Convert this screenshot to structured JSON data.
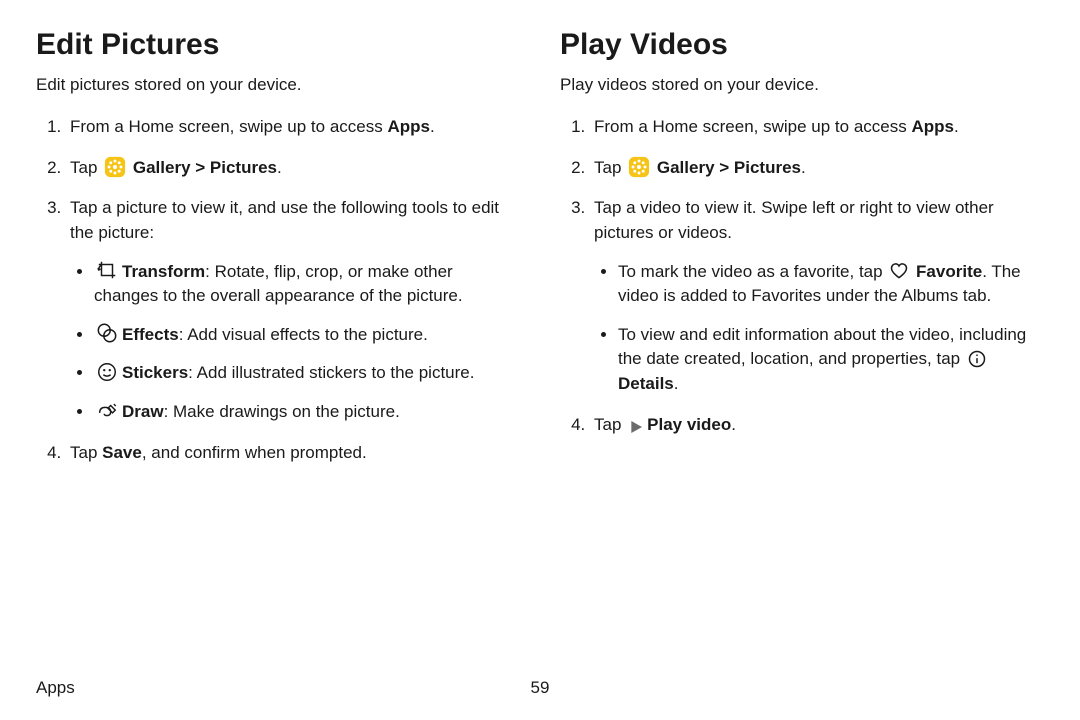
{
  "left": {
    "heading": "Edit Pictures",
    "intro": "Edit pictures stored on your device.",
    "step1_pre": "From a Home screen, swipe up to access ",
    "step1_bold": "Apps",
    "step1_post": ".",
    "step2_pre": "Tap ",
    "step2_bold": "Gallery > Pictures",
    "step2_post": ".",
    "step3": "Tap a picture to view it, and use the following tools to edit the picture:",
    "tools": {
      "transform_label": "Transform",
      "transform_text": ": Rotate, flip, crop, or make other changes to the overall appearance of the picture.",
      "effects_label": "Effects",
      "effects_text": ": Add visual effects to the picture.",
      "stickers_label": "Stickers",
      "stickers_text": ": Add illustrated stickers to the picture.",
      "draw_label": "Draw",
      "draw_text": ": Make drawings on the picture."
    },
    "step4_pre": "Tap ",
    "step4_bold": "Save",
    "step4_post": ", and confirm when prompted."
  },
  "right": {
    "heading": "Play Videos",
    "intro": "Play videos stored on your device.",
    "step1_pre": "From a Home screen, swipe up to access ",
    "step1_bold": "Apps",
    "step1_post": ".",
    "step2_pre": "Tap ",
    "step2_bold": "Gallery > Pictures",
    "step2_post": ".",
    "step3": "Tap a video to view it. Swipe left or right to view other pictures or videos.",
    "bullets": {
      "fav_pre": "To mark the video as a favorite, tap ",
      "fav_bold": "Favorite",
      "fav_post": ". The video is added to Favorites under the Albums tab.",
      "details_pre": "To view and edit information about the video, including the date created, location, and properties, tap ",
      "details_bold": "Details",
      "details_post": "."
    },
    "step4_pre": "Tap ",
    "step4_bold": "Play video",
    "step4_post": "."
  },
  "footer": {
    "section": "Apps",
    "page": "59"
  }
}
